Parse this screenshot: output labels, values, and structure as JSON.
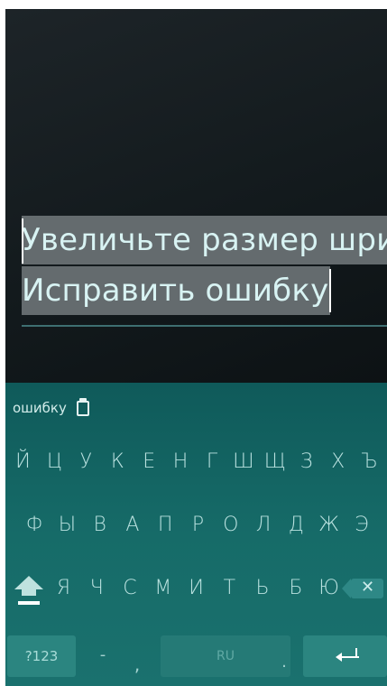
{
  "editor": {
    "line1": "Увеличьте размер шри",
    "line2": "Исправить ошибку"
  },
  "keyboard": {
    "prediction": "ошибку",
    "clipboard_icon": "clipboard-icon",
    "row1": [
      "Й",
      "Ц",
      "У",
      "К",
      "Е",
      "Н",
      "Г",
      "Ш",
      "Щ",
      "З",
      "Х",
      "Ъ"
    ],
    "row2": [
      "Ф",
      "Ы",
      "В",
      "А",
      "П",
      "Р",
      "О",
      "Л",
      "Д",
      "Ж",
      "Э"
    ],
    "row3": [
      "Я",
      "Ч",
      "С",
      "М",
      "И",
      "Т",
      "Ь",
      "Б",
      "Ю"
    ],
    "symbols_label": "?123",
    "dash": "-",
    "comma": ",",
    "space_label": "RU",
    "period": ".",
    "shift_icon": "shift-icon",
    "backspace_icon": "backspace-icon",
    "enter_icon": "enter-icon"
  },
  "colors": {
    "keyboard_bg": "#166b68",
    "selection_bg": "#646b6e",
    "text_accent": "#d8f3f3"
  }
}
